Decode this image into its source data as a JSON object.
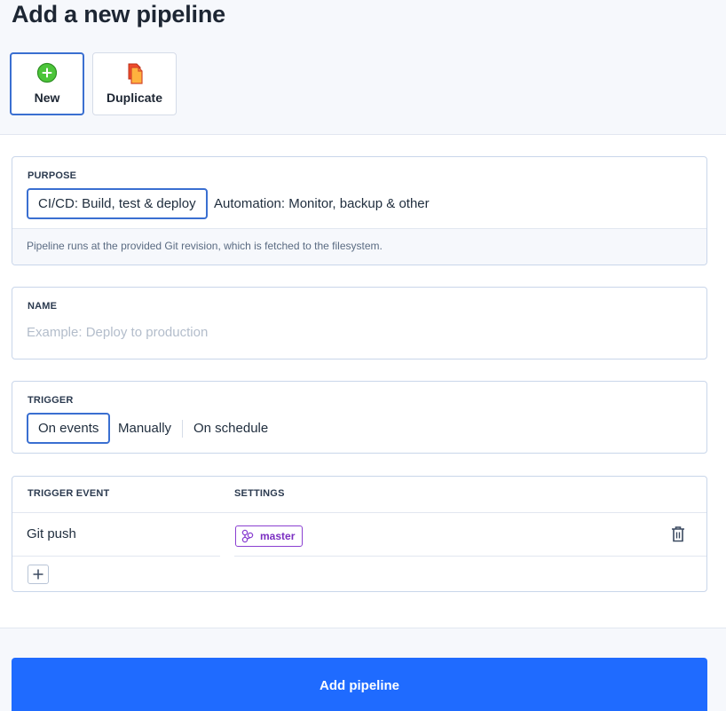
{
  "page": {
    "title": "Add a new pipeline"
  },
  "modes": [
    {
      "label": "New",
      "icon": "plus-circle-icon",
      "active": true
    },
    {
      "label": "Duplicate",
      "icon": "duplicate-icon",
      "active": false
    }
  ],
  "purpose": {
    "label": "PURPOSE",
    "options": [
      "CI/CD: Build, test & deploy",
      "Automation: Monitor, backup & other"
    ],
    "selected": "CI/CD: Build, test & deploy",
    "hint": "Pipeline runs at the provided Git revision, which is fetched to the filesystem."
  },
  "name": {
    "label": "NAME",
    "value": "",
    "placeholder": "Example: Deploy to production"
  },
  "trigger": {
    "label": "TRIGGER",
    "options": [
      "On events",
      "Manually",
      "On schedule"
    ],
    "selected": "On events"
  },
  "events": {
    "columns": [
      "TRIGGER EVENT",
      "SETTINGS"
    ],
    "rows": [
      {
        "event": "Git push",
        "branch": "master",
        "branch_icon": "branch-icon",
        "delete_icon": "trash-icon"
      }
    ],
    "add_icon": "plus-icon"
  },
  "footer": {
    "submit_label": "Add pipeline"
  },
  "colors": {
    "accent": "#1f6bff",
    "active_border": "#3a6fd1",
    "branch_badge": "#8a3fd1",
    "header_bg": "#f6f8fc"
  }
}
